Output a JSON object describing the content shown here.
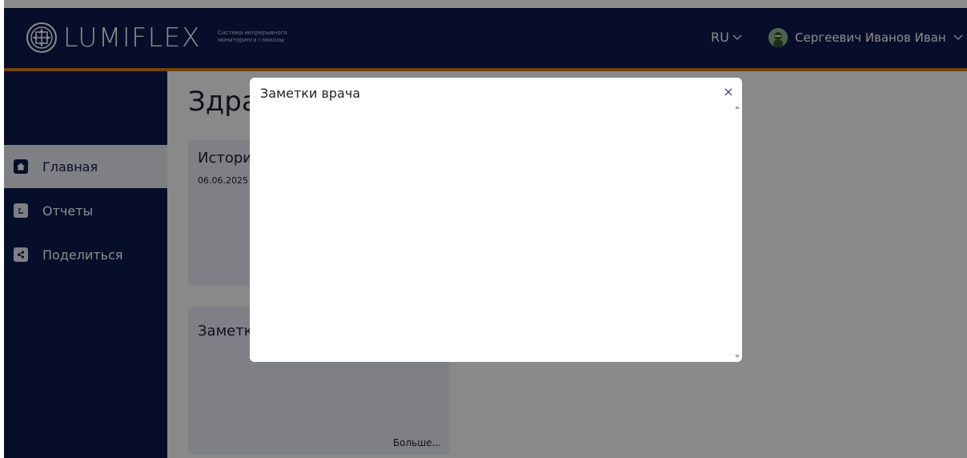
{
  "header": {
    "brand": "LUMIFLEX",
    "tagline": "Система непрерывного мониторинга глюкозы",
    "language": "RU",
    "user_name": "Сергеевич Иванов Иван"
  },
  "sidebar": {
    "items": [
      {
        "label": "Главная",
        "icon": "home-icon",
        "active": true
      },
      {
        "label": "Отчеты",
        "icon": "reports-icon",
        "active": false
      },
      {
        "label": "Поделиться",
        "icon": "share-icon",
        "active": false
      }
    ]
  },
  "main": {
    "page_title": "Здра",
    "cards": [
      {
        "title": "Истори",
        "date": "06.06.2025"
      },
      {
        "title": "Заметк",
        "more_label": "Больше..."
      }
    ]
  },
  "modal": {
    "title": "Заметки врача",
    "close_glyph": "×"
  },
  "colors": {
    "navy": "#0d1a4d",
    "accent": "#d47a16"
  }
}
